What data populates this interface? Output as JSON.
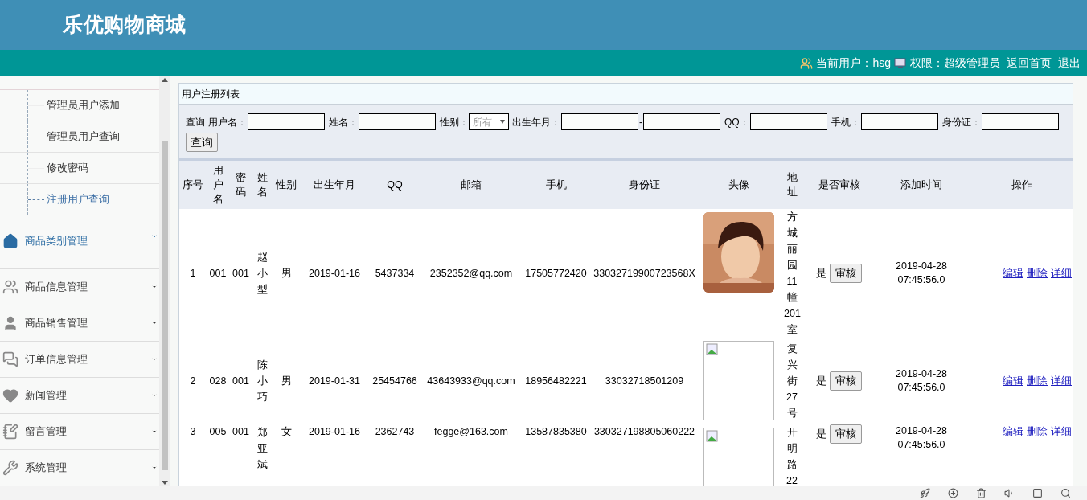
{
  "header": {
    "title": "乐优购物商城"
  },
  "topbar": {
    "user_label": "当前用户：hsg",
    "role_label": "权限：超级管理员",
    "links": [
      "返回首页",
      "退出"
    ]
  },
  "sidebar": {
    "sub_items": [
      {
        "label": "管理员用户添加",
        "selected": false
      },
      {
        "label": "管理员用户查询",
        "selected": false
      },
      {
        "label": "修改密码",
        "selected": false
      },
      {
        "label": "注册用户查询",
        "selected": true
      }
    ],
    "items": [
      {
        "label": "商品类别管理",
        "kind": "home",
        "selected": true
      },
      {
        "label": "商品信息管理",
        "kind": "users",
        "selected": false
      },
      {
        "label": "商品销售管理",
        "kind": "user",
        "selected": false
      },
      {
        "label": "订单信息管理",
        "kind": "chat",
        "selected": false
      },
      {
        "label": "新闻管理",
        "kind": "heart",
        "selected": false
      },
      {
        "label": "留言管理",
        "kind": "note",
        "selected": false
      },
      {
        "label": "系统管理",
        "kind": "tools",
        "selected": false
      }
    ]
  },
  "panel": {
    "title": "用户注册列表",
    "search": {
      "prefix": "查询",
      "fields": [
        {
          "label": "用户名：",
          "kind": "input"
        },
        {
          "label": "姓名：",
          "kind": "input"
        },
        {
          "label": "性别：",
          "kind": "select",
          "value": "所有"
        },
        {
          "label": "出生年月：",
          "kind": "range",
          "separator": "-"
        },
        {
          "label": "QQ：",
          "kind": "input"
        },
        {
          "label": "手机：",
          "kind": "input"
        },
        {
          "label": "身份证：",
          "kind": "input"
        }
      ],
      "button": "查询"
    },
    "table": {
      "columns": [
        "序号",
        "用户名",
        "密码",
        "姓名",
        "性别",
        "出生年月",
        "QQ",
        "邮箱",
        "手机",
        "身份证",
        "头像",
        "地址",
        "是否审核",
        "添加时间",
        "操作"
      ],
      "rows": [
        {
          "no": "1",
          "username": "001",
          "password": "001",
          "name": "赵小型",
          "gender": "男",
          "birth": "2019-01-16",
          "qq": "5437334",
          "email": "2352352@qq.com",
          "phone": "17505772420",
          "id_card": "33032719900723568X",
          "avatar": {
            "kind": "picture"
          },
          "address": "方城丽园11幢201室",
          "approved": "是",
          "approve_button": "审核",
          "added": "2019-04-28 07:45:56.0",
          "actions": [
            "编辑",
            "删除",
            "详细"
          ]
        },
        {
          "no": "2",
          "username": "028",
          "password": "001",
          "name": "陈小巧",
          "gender": "男",
          "birth": "2019-01-31",
          "qq": "25454766",
          "email": "43643933@qq.com",
          "phone": "18956482221",
          "id_card": "33032718501209",
          "avatar": {
            "kind": "broken"
          },
          "address": "复兴街27号",
          "approved": "是",
          "approve_button": "审核",
          "added": "2019-04-28 07:45:56.0",
          "actions": [
            "编辑",
            "删除",
            "详细"
          ]
        },
        {
          "no": "3",
          "username": "005",
          "password": "001",
          "name": "郑亚斌",
          "gender": "女",
          "birth": "2019-01-16",
          "qq": "2362743",
          "email": "fegge@163.com",
          "phone": "13587835380",
          "id_card": "330327198805060222",
          "avatar": {
            "kind": "broken"
          },
          "address": "开明路22",
          "approved": "是",
          "approve_button": "审核",
          "added": "2019-04-28 07:45:56.0",
          "actions": [
            "编辑",
            "删除",
            "详细"
          ]
        }
      ]
    }
  }
}
